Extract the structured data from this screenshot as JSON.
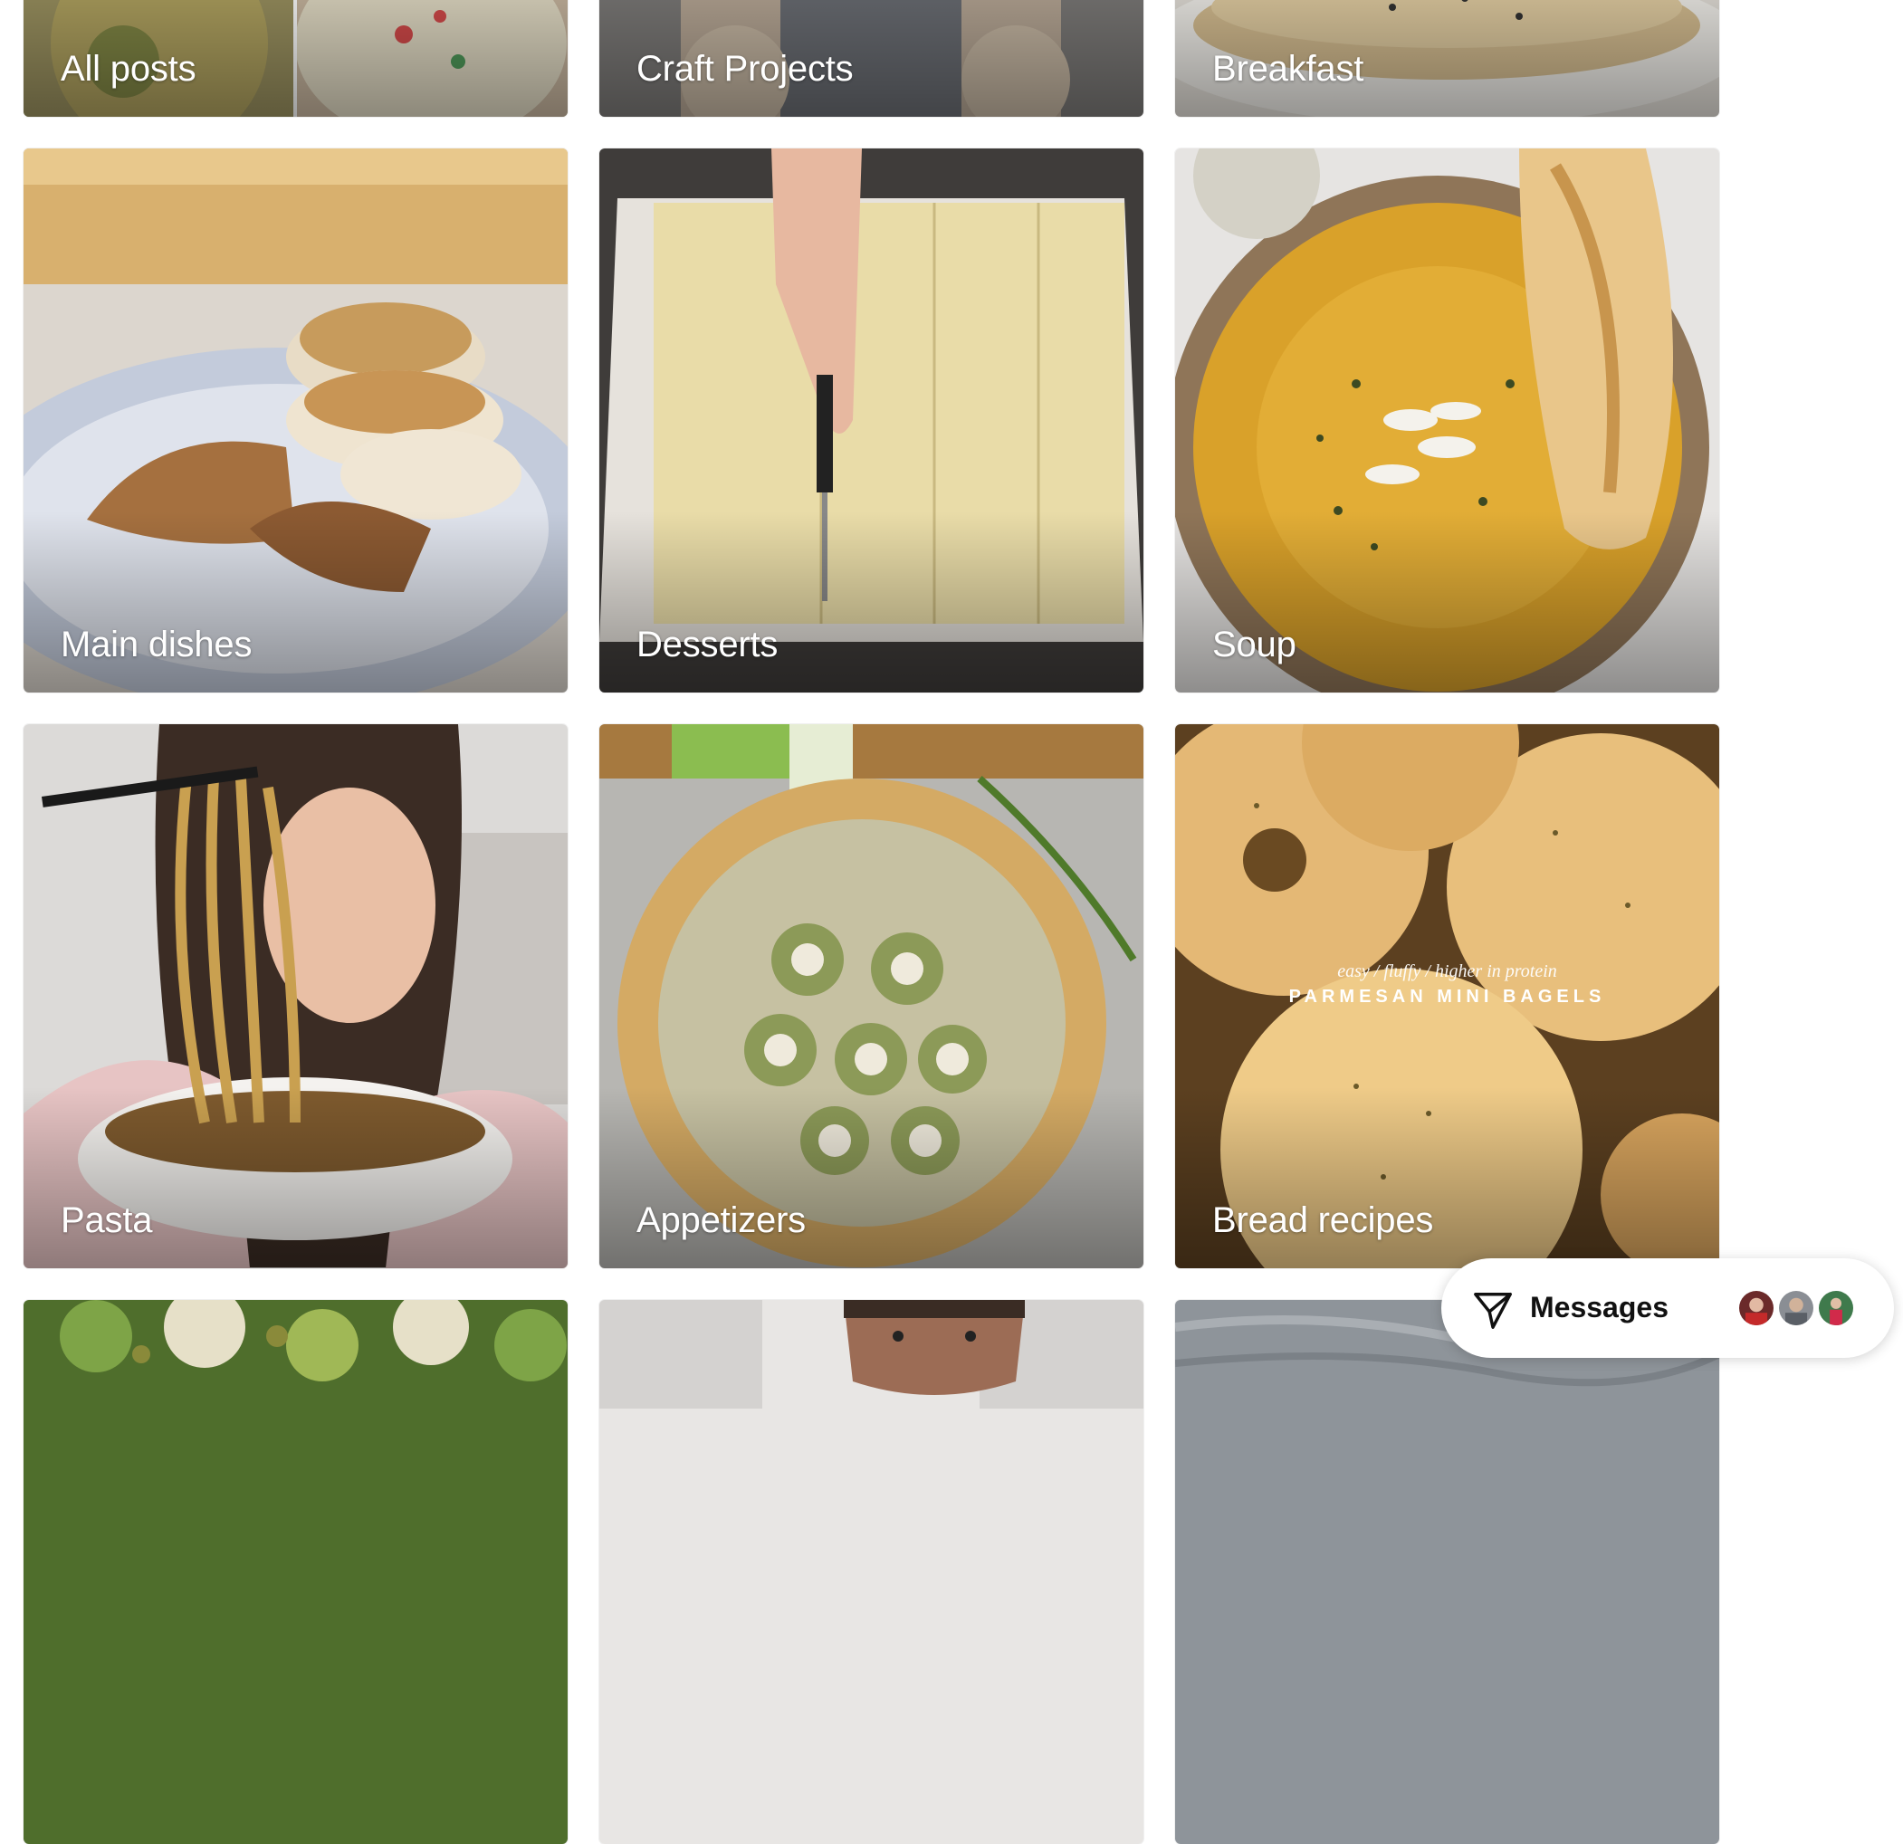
{
  "categories": [
    {
      "id": "all-posts",
      "label": "All posts"
    },
    {
      "id": "craft-projects",
      "label": "Craft Projects"
    },
    {
      "id": "breakfast",
      "label": "Breakfast"
    },
    {
      "id": "main-dishes",
      "label": "Main dishes"
    },
    {
      "id": "desserts",
      "label": "Desserts"
    },
    {
      "id": "soup",
      "label": "Soup"
    },
    {
      "id": "pasta",
      "label": "Pasta"
    },
    {
      "id": "appetizers",
      "label": "Appetizers"
    },
    {
      "id": "bread-recipes",
      "label": "Bread recipes"
    }
  ],
  "bagel_overlay": {
    "subtitle": "easy / fluffy / higher in protein",
    "title": "PARMESAN MINI BAGELS"
  },
  "messages": {
    "label": "Messages",
    "icon": "send-icon"
  },
  "colors": {
    "tile_label": "#ffffff",
    "pill_background": "#ffffff"
  }
}
